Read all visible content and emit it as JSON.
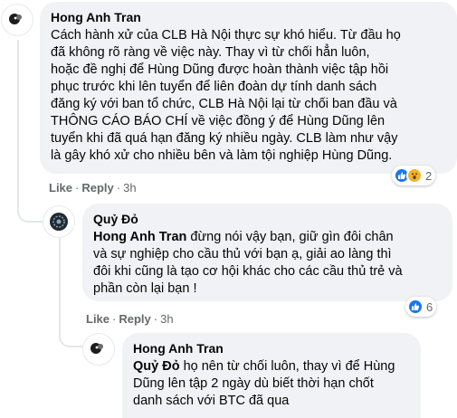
{
  "comments": [
    {
      "author": "Hong Anh Tran",
      "lines": [
        "Cách hành xử của CLB Hà Nội thực sự khó hiểu. Từ đầu họ",
        "đã không rõ ràng về việc này. Thay vì từ chối hẳn luôn,",
        "hoặc đề nghị để Hùng Dũng được hoàn thành việc tập hồi",
        "phục trước khi lên tuyển để liên đoàn dự tính danh sách",
        "đăng ký với ban tổ chức, CLB Hà Nội lại từ chối ban đầu và",
        "THÔNG CÁO BÁO CHÍ về việc đồng ý để Hùng Dũng lên",
        "tuyển khi đã quá hạn đăng ký nhiều ngày. CLB làm như vậy",
        "là gây khó xử cho nhiều bên và làm tội nghiệp Hùng Dũng."
      ],
      "like_label": "Like",
      "reply_label": "Reply",
      "time": "3h",
      "reaction_count": "2",
      "reaction_icons": [
        "like-icon",
        "wow-icon"
      ]
    },
    {
      "author": "Quỷ Đỏ",
      "mention": "Hong Anh Tran",
      "first_line_rest": " đừng nói vậy bạn, giữ gìn đôi chân",
      "lines": [
        "và sự nghiệp cho cầu thủ với bạn ạ, giải ao làng thì",
        "đôi khi cũng là tạo cơ hội khác cho các cầu thủ trẻ và",
        "phần còn lại bạn !"
      ],
      "like_label": "Like",
      "reply_label": "Reply",
      "time": "3h",
      "reaction_count": "6",
      "reaction_icons": [
        "like-icon"
      ]
    },
    {
      "author": "Hong Anh Tran",
      "mention": "Quỷ Đỏ",
      "first_line_rest": " họ nên từ chối luôn, thay vì để Hùng",
      "lines": [
        "Dũng lên tập 2 ngày dù biết thời hạn chốt",
        "danh sách với BTC đã qua"
      ]
    }
  ],
  "separator": "·",
  "colors": {
    "bubble": "#f0f2f5",
    "meta_text": "#65676b",
    "like_blue": "#1877f2",
    "wow_yellow": "#f7b125"
  }
}
